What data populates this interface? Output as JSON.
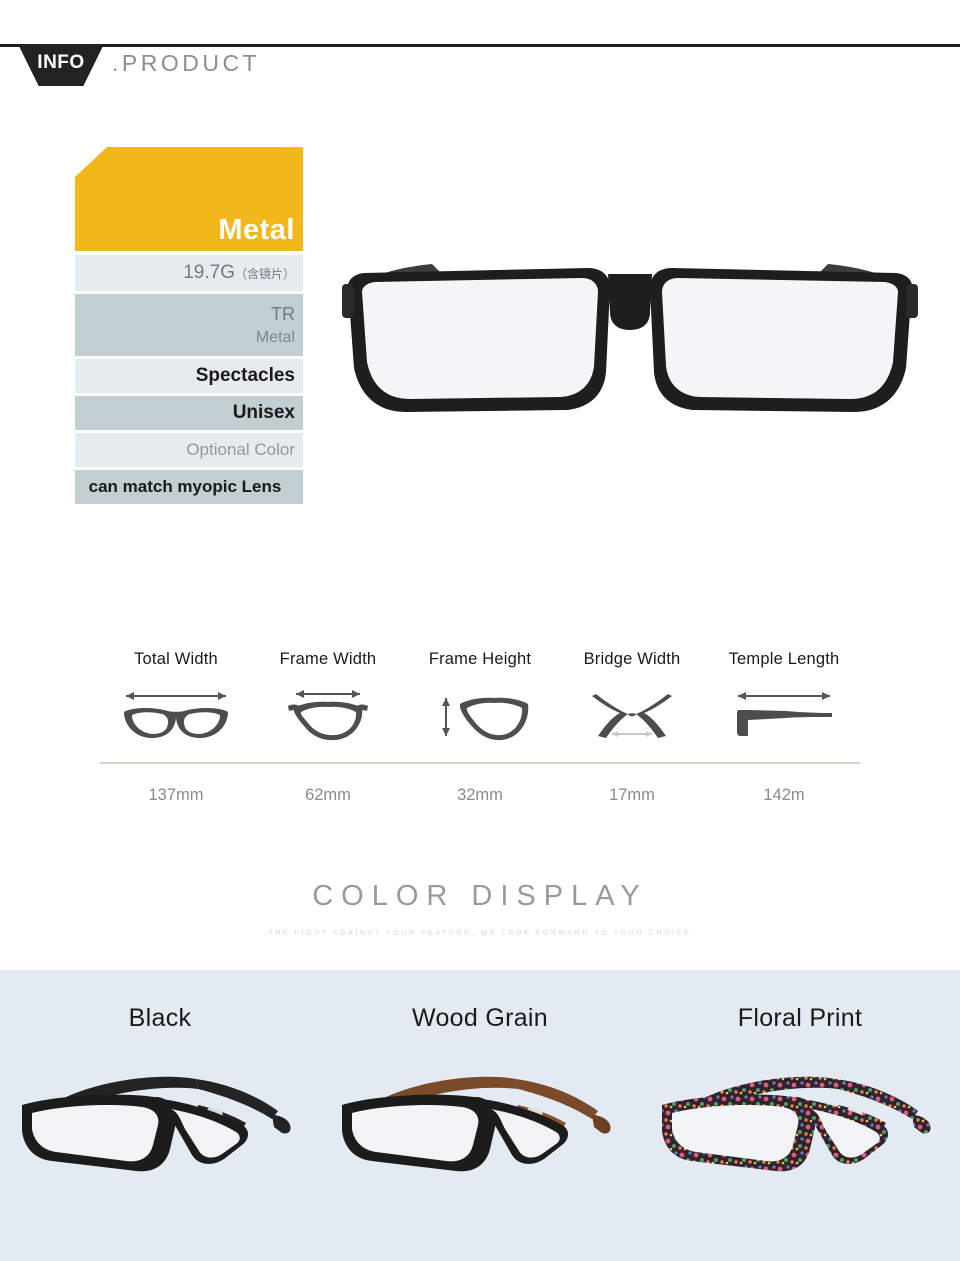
{
  "header": {
    "badge": "INFO",
    "title": ".PRODUCT",
    "badge_icon": "info-badge-icon"
  },
  "spec": {
    "rows": [
      {
        "name": "material-title",
        "value": "Metal"
      },
      {
        "name": "weight",
        "value": "19.7G",
        "note": "（含镜片）"
      },
      {
        "name": "materials",
        "line1": "TR",
        "line2": "Metal"
      },
      {
        "name": "product-type",
        "value": "Spectacles"
      },
      {
        "name": "gender",
        "value": "Unisex"
      },
      {
        "name": "color-option",
        "value": "Optional Color"
      },
      {
        "name": "lens-option",
        "value": "can match myopic Lens"
      }
    ],
    "accent_color": "#f2b71a",
    "row_light_color": "#e5ebef",
    "row_dark_color": "#c2ced2"
  },
  "dimensions": {
    "columns": [
      {
        "label": "Total Width",
        "value": "137mm",
        "icon": "glasses-total-width-icon"
      },
      {
        "label": "Frame Width",
        "value": "62mm",
        "icon": "lens-frame-width-icon"
      },
      {
        "label": "Frame Height",
        "value": "32mm",
        "icon": "lens-frame-height-icon"
      },
      {
        "label": "Bridge Width",
        "value": "17mm",
        "icon": "bridge-width-icon"
      },
      {
        "label": "Temple Length",
        "value": "142m",
        "icon": "temple-length-icon"
      }
    ],
    "rule_color": "#d9d6c4"
  },
  "color_display": {
    "title": "COLOR DISPLAY",
    "subtitle": "THE FIGHT AGAINST YOUR FEATURE, WE LOOK FORWARD TO YOUR CHOICE",
    "background": "#e4eaf1",
    "variants": [
      {
        "name": "Black",
        "frame_color": "#1c1c1c",
        "temple_color": "#232323",
        "accent": "#cfcfcf"
      },
      {
        "name": "Wood Grain",
        "frame_color": "#1c1c1c",
        "temple_color": "#7a4a2a",
        "accent": "#ddd4c0"
      },
      {
        "name": "Floral Print",
        "frame_color": "#3a2a33",
        "temple_color": "#4a3340",
        "accent": "#e8e2d8"
      }
    ]
  }
}
